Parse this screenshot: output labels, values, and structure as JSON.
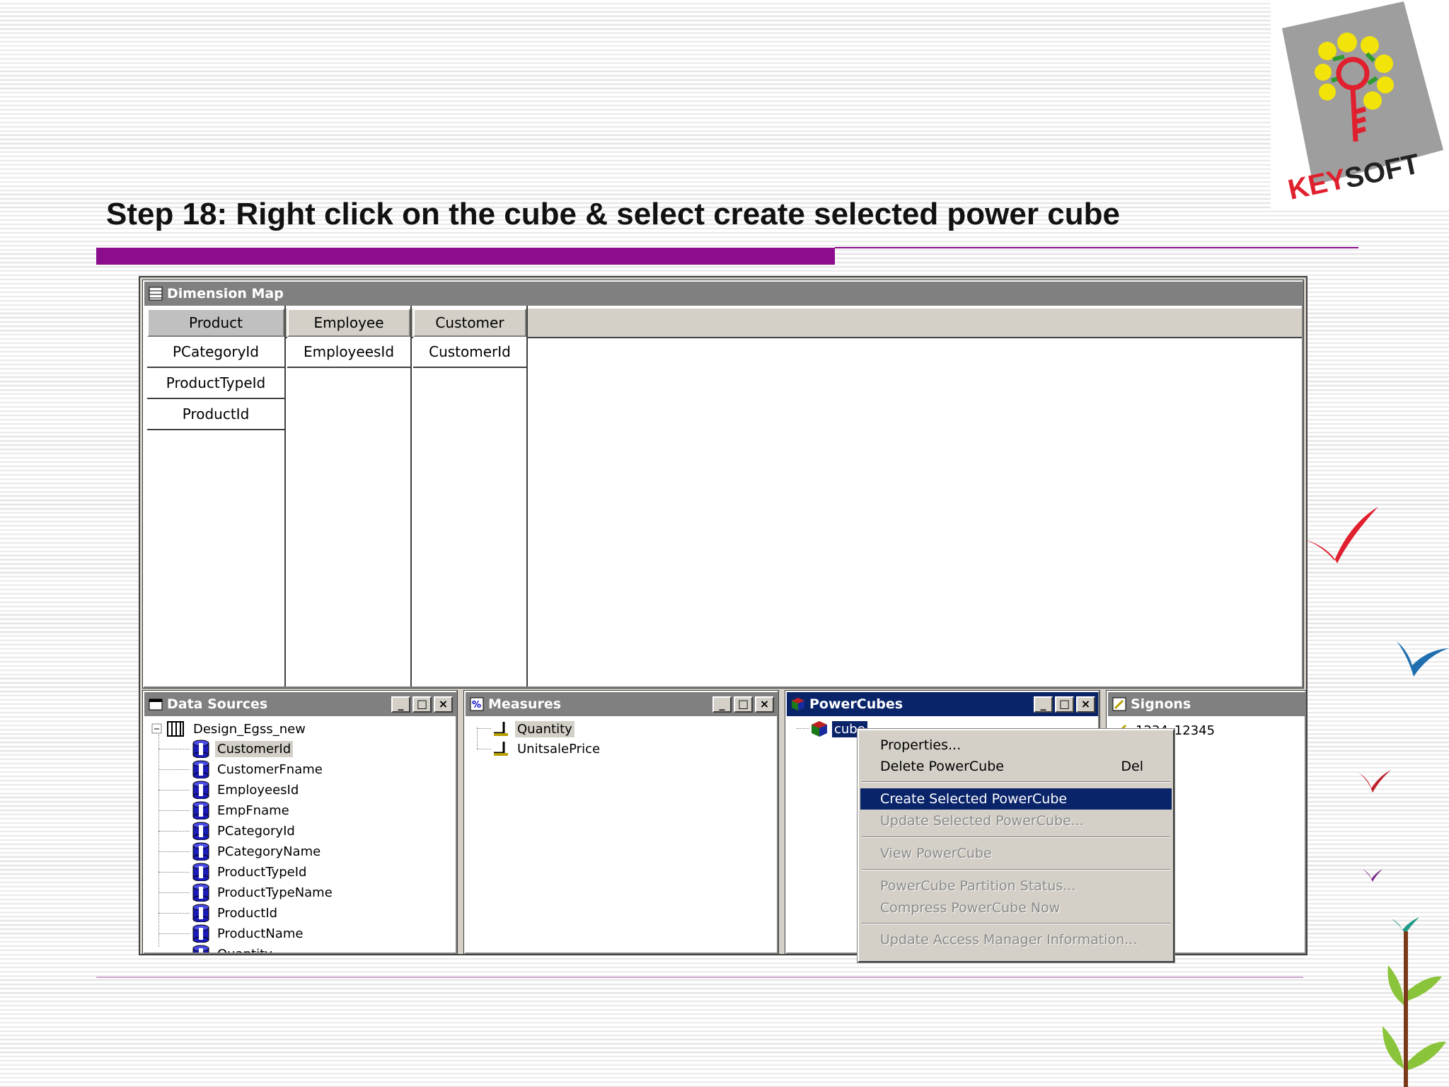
{
  "slide": {
    "title": "Step 18: Right click on the cube & select create selected power cube",
    "logo_text": "KEYSOFT"
  },
  "colors": {
    "accent_purple": "#8b0c8c",
    "active_title": "#0a246a",
    "inactive_title": "#808080",
    "window_face": "#d4d0c8"
  },
  "dimension_map": {
    "title": "Dimension Map",
    "columns": [
      {
        "header": "Product",
        "levels": [
          "PCategoryId",
          "ProductTypeId",
          "ProductId"
        ]
      },
      {
        "header": "Employee",
        "levels": [
          "EmployeesId"
        ]
      },
      {
        "header": "Customer",
        "levels": [
          "CustomerId"
        ]
      }
    ]
  },
  "data_sources": {
    "title": "Data Sources",
    "root": "Design_Egss_new",
    "items": [
      "CustomerId",
      "CustomerFname",
      "EmployeesId",
      "EmpFname",
      "PCategoryId",
      "PCategoryName",
      "ProductTypeId",
      "ProductTypeName",
      "ProductId",
      "ProductName",
      "Quantity"
    ],
    "selected": "CustomerId"
  },
  "measures": {
    "title": "Measures",
    "items": [
      "Quantity",
      "UnitsalePrice"
    ],
    "selected": "Quantity"
  },
  "powercubes": {
    "title": "PowerCubes",
    "item": "cube"
  },
  "signons": {
    "title": "Signons",
    "item": "1234_12345"
  },
  "window_buttons": {
    "minimize": "_",
    "maximize": "□",
    "close": "×"
  },
  "context_menu": {
    "items": [
      {
        "label": "Properties...",
        "enabled": true
      },
      {
        "label": "Delete PowerCube",
        "shortcut": "Del",
        "enabled": true
      },
      {
        "label": "Create Selected PowerCube",
        "enabled": true,
        "highlighted": true
      },
      {
        "label": "Update Selected PowerCube...",
        "enabled": false
      },
      {
        "label": "View PowerCube",
        "enabled": false
      },
      {
        "label": "PowerCube Partition Status...",
        "enabled": false
      },
      {
        "label": "Compress PowerCube Now",
        "enabled": false
      },
      {
        "label": "Update Access Manager Information...",
        "enabled": false
      }
    ]
  }
}
